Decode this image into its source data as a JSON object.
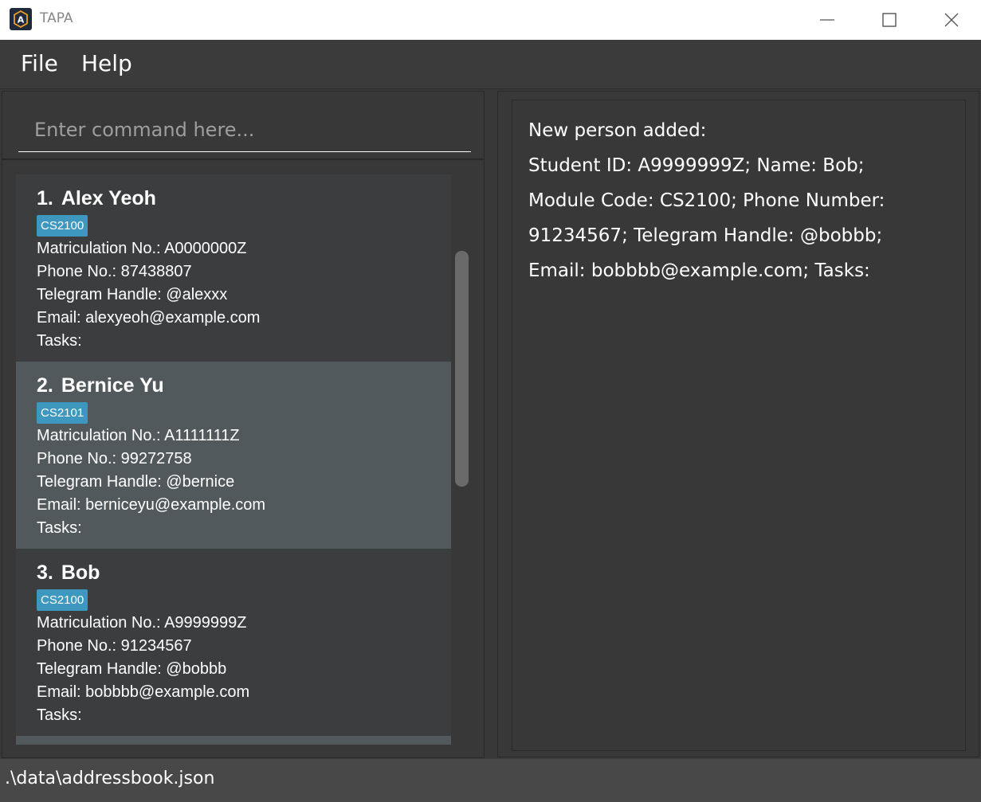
{
  "window": {
    "title": "TAPA",
    "icon": "app-logo-icon",
    "controls": [
      "minimize-icon",
      "maximize-icon",
      "close-icon"
    ]
  },
  "menu": {
    "file": "File",
    "help": "Help"
  },
  "command": {
    "placeholder": "Enter command here..."
  },
  "persons": [
    {
      "index": "1.",
      "name": "Alex Yeoh",
      "tag": "CS2100",
      "matric": "Matriculation No.: A0000000Z",
      "phone": "Phone No.: 87438807",
      "telegram": "Telegram Handle: @alexxx",
      "email": "Email: alexyeoh@example.com",
      "tasks": "Tasks:"
    },
    {
      "index": "2.",
      "name": "Bernice Yu",
      "tag": "CS2101",
      "matric": "Matriculation No.: A1111111Z",
      "phone": "Phone No.: 99272758",
      "telegram": "Telegram Handle: @bernice",
      "email": "Email: berniceyu@example.com",
      "tasks": "Tasks:"
    },
    {
      "index": "3.",
      "name": "Bob",
      "tag": "CS2100",
      "matric": "Matriculation No.: A9999999Z",
      "phone": "Phone No.: 91234567",
      "telegram": "Telegram Handle: @bobbb",
      "email": "Email: bobbbb@example.com",
      "tasks": "Tasks:"
    }
  ],
  "result": {
    "lines": [
      "New person added:",
      "Student ID: A9999999Z; Name: Bob;",
      "Module Code: CS2100; Phone Number:",
      "91234567; Telegram Handle: @bobbb;",
      "Email: bobbbb@example.com; Tasks:"
    ]
  },
  "status": {
    "path": ".\\data\\addressbook.json"
  },
  "colors": {
    "background": "#383838",
    "card": "#3b3d3f",
    "card_selected": "#52595d",
    "tag": "#3e97bf",
    "statusbar": "#484848"
  }
}
